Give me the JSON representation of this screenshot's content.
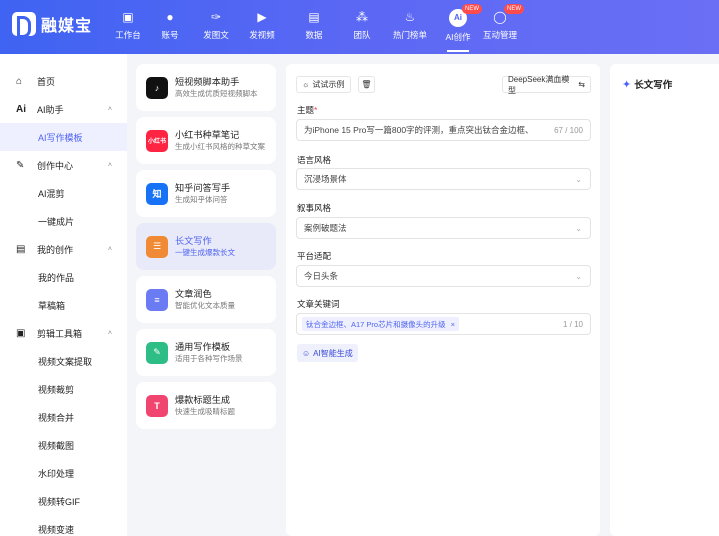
{
  "app": {
    "logo_text": "融媒宝"
  },
  "top_nav": [
    {
      "label": "工作台",
      "icon": "monitor-icon"
    },
    {
      "label": "账号",
      "icon": "user-icon"
    },
    {
      "label": "发图文",
      "icon": "feather-icon"
    },
    {
      "label": "发视频",
      "icon": "play-icon"
    },
    {
      "label": "数据",
      "icon": "chart-icon"
    },
    {
      "label": "团队",
      "icon": "team-icon"
    },
    {
      "label": "热门榜单",
      "icon": "flame-icon"
    },
    {
      "label": "AI创作",
      "icon": "ai-icon",
      "badge": "NEW",
      "icon_text": "Ai"
    },
    {
      "label": "互动管理",
      "icon": "chat-icon",
      "badge": "NEW"
    }
  ],
  "sidebar": {
    "home": "首页",
    "ai_helper": "AI助手",
    "ai_writing_template": "AI写作模板",
    "creation_center": "创作中心",
    "ai_clip": "AI混剪",
    "one_click": "一键成片",
    "my_creation": "我的创作",
    "my_works": "我的作品",
    "drafts": "草稿箱",
    "edit_tools": "剪辑工具箱",
    "tool_items": [
      "视频文案提取",
      "视频裁剪",
      "视频合并",
      "视频截图",
      "水印处理",
      "视频转GIF",
      "视频变速"
    ]
  },
  "templates": [
    {
      "title": "短视频脚本助手",
      "desc": "高效生成优质短视频脚本",
      "icon": "tiktok-icon",
      "icon_text": "♪",
      "color": "#111111"
    },
    {
      "title": "小红书种草笔记",
      "desc": "生成小红书风格的种草文案",
      "icon": "xiaohongshu-icon",
      "icon_text": "小红书",
      "color": "#ff2442"
    },
    {
      "title": "知乎问答写手",
      "desc": "生成知乎体问答",
      "icon": "zhihu-icon",
      "icon_text": "知",
      "color": "#1772f6"
    },
    {
      "title": "长文写作",
      "desc": "一键生成爆款长文",
      "icon": "longform-icon",
      "icon_text": "☰",
      "color": "#f08a34"
    },
    {
      "title": "文章润色",
      "desc": "智能优化文本质量",
      "icon": "polish-icon",
      "icon_text": "≡",
      "color": "#6b7bf3"
    },
    {
      "title": "通用写作模板",
      "desc": "适用于各种写作场景",
      "icon": "edit-icon",
      "icon_text": "✎",
      "color": "#2ebd85"
    },
    {
      "title": "爆款标题生成",
      "desc": "快速生成吸睛标题",
      "icon": "title-icon",
      "icon_text": "T",
      "color": "#f0456f"
    }
  ],
  "form": {
    "try_example": "试试示例",
    "model": "DeepSeek满血模型",
    "topic_label": "主题",
    "topic_value": "为iPhone 15 Pro写一篇800字的评测，重点突出钛合金边框、",
    "topic_count": "67 / 100",
    "language_label": "语言风格",
    "language_value": "沉浸场景体",
    "narrative_label": "叙事风格",
    "narrative_value": "案例破题法",
    "platform_label": "平台适配",
    "platform_value": "今日头条",
    "keywords_label": "文章关键词",
    "keyword_tag": "钛合金边框、A17 Pro芯片和摄像头的升级",
    "keyword_count": "1 / 10",
    "ai_generate": "AI智能生成"
  },
  "right_panel": {
    "title": "长文写作"
  }
}
